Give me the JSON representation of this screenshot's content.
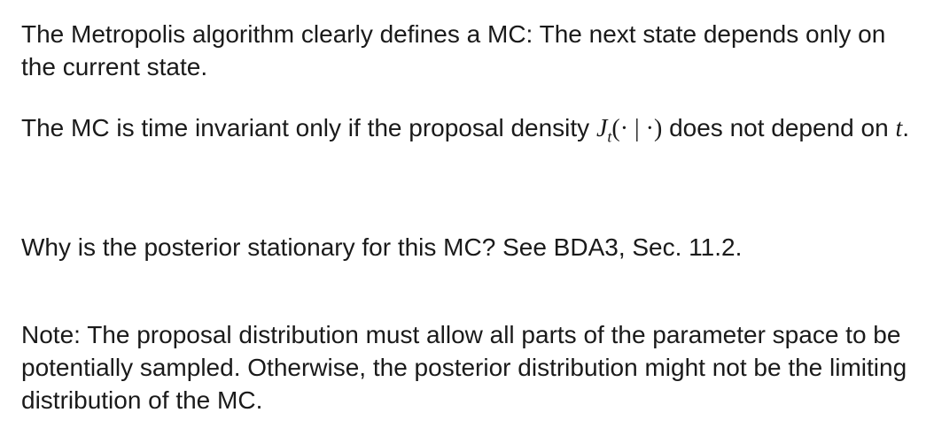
{
  "slide": {
    "paragraph_1": "The Metropolis algorithm clearly defines a MC: The next state depends only on the current state.",
    "paragraph_2": {
      "before_math": "The MC is time invariant only if the proposal density ",
      "math_symbol": "J",
      "math_subscript": "t",
      "math_args": "(· | ·)",
      "after_math": " does not depend on ",
      "math_var": "t",
      "end": "."
    },
    "paragraph_3": "Why is the posterior stationary for this MC? See BDA3, Sec. 11.2.",
    "paragraph_4": "Note: The proposal distribution must allow all parts of the parameter space to be potentially sampled. Otherwise, the posterior distribution might not be the limiting distribution of the MC."
  }
}
